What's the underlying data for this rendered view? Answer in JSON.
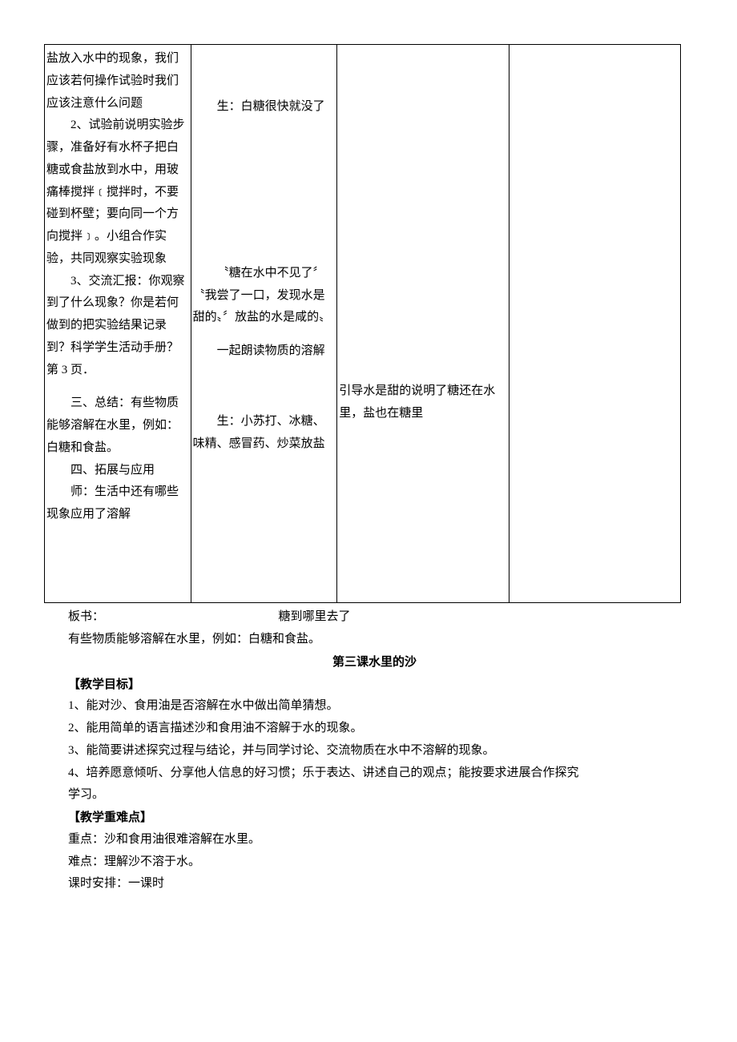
{
  "table": {
    "col1": {
      "p1": "盐放入水中的现象，我们应该若何操作试验时我们应该注意什么问题",
      "p2": "2、试验前说明实验步骤，准备好有水杯子把白糖或食盐放到水中，用玻痛棒搅拌﹝搅拌时，不要碰到杯壁；要向同一个方向搅拌﹞。小组合作实验，共同观察实验现象",
      "p3": "3、交流汇报：你观察到了什么现象？你是若何做到的把实验结果记录到？科学学生活动手册？第 3 页．",
      "p4": "三、总结：有些物质能够溶解在水里，例如：白糖和食盐。",
      "p5": "四、拓展与应用",
      "p6": "师：生活中还有哪些现象应用了溶解"
    },
    "col2": {
      "p1": "生：白糖很快就没了",
      "p2": "〝糖在水中不见了〞〝我尝了一口，发现水是甜的〟〞放盐的水是咸的〟",
      "p3": "一起朗读物质的溶解",
      "p4": "生：小苏打、冰糖、味精、感冒药、炒菜放盐"
    },
    "col3": {
      "p1": "引导水是甜的说明了糖还在水里，盐也在糖里"
    }
  },
  "below": {
    "board_label": "板书：",
    "board_title": "糖到哪里去了",
    "board_content": "有些物质能够溶解在水里，例如：白糖和食盐。",
    "lesson_title": "第三课水里的沙",
    "goals_label": "【教学目标】",
    "goal1": "1、能对沙、食用油是否溶解在水中做出简单猜想。",
    "goal2": "2、能用简单的语言描述沙和食用油不溶解于水的现象。",
    "goal3": "3、能简要讲述探究过程与结论，并与同学讨论、交流物质在水中不溶解的现象。",
    "goal4": "4、培养愿意倾听、分享他人信息的好习惯；乐于表达、讲述自己的观点；能按要求进展合作探究学习。",
    "difficulty_label": "【教学重难点】",
    "key_point": "重点：沙和食用油很难溶解在水里。",
    "hard_point": "难点：理解沙不溶于水。",
    "schedule": "课时安排：一课时"
  }
}
